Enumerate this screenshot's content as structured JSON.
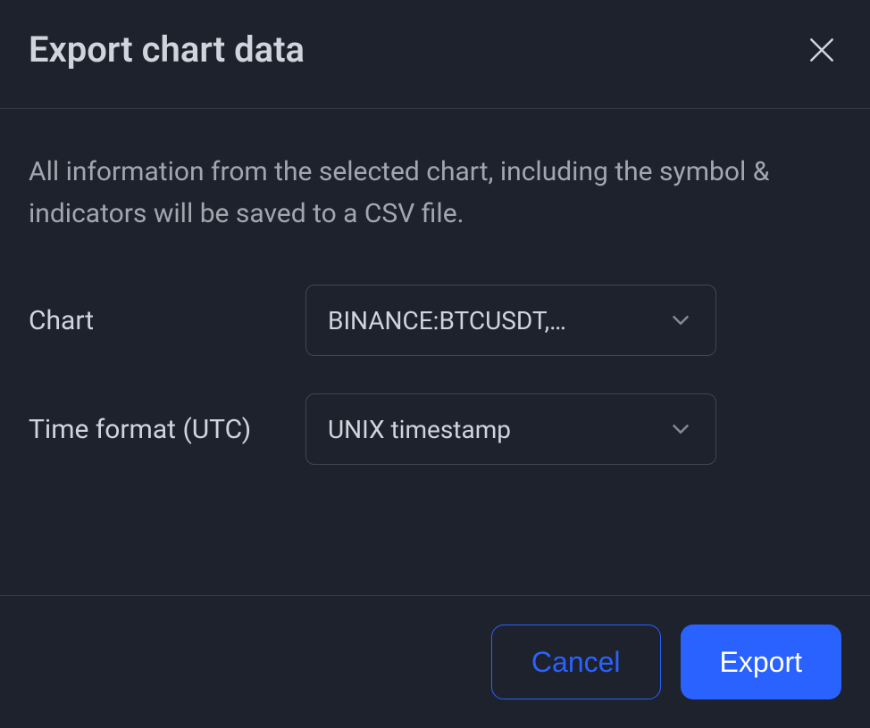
{
  "dialog": {
    "title": "Export chart data",
    "description": "All information from the selected chart, including the symbol & indicators will be saved to a CSV file.",
    "fields": {
      "chart": {
        "label": "Chart",
        "value": "BINANCE:BTCUSDT,…"
      },
      "time_format": {
        "label": "Time format (UTC)",
        "value": "UNIX timestamp"
      }
    },
    "buttons": {
      "cancel": "Cancel",
      "export": "Export"
    }
  }
}
